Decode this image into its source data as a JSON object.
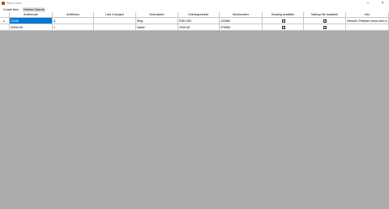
{
  "window": {
    "title": "Sales Data"
  },
  "menu": {
    "create_new": "Create New",
    "deleted_objects": "Deleted Objects"
  },
  "grid": {
    "columns": [
      "Articlecode",
      "Articlesku",
      "Last Changed",
      "Description",
      "Drawingnumber",
      "Idestnumber",
      "Drawing available",
      "Markup file available",
      "Info"
    ],
    "current_row_marker": "►",
    "rows": [
      {
        "articlecode": "12345",
        "articlesku": "A",
        "last_changed": "",
        "description": "Ring",
        "drawingnumber": "RGD-200",
        "idestnumber": "122584",
        "drawing_available": true,
        "markup_available": true,
        "info": "Hinweis: Prüfplan muss noch e..."
      },
      {
        "articlecode": "42543-90",
        "articlesku": "1",
        "last_changed": "",
        "description": "Nabel",
        "drawingnumber": "2930-45",
        "idestnumber": "376965",
        "drawing_available": true,
        "markup_available": true,
        "info": ""
      }
    ]
  }
}
